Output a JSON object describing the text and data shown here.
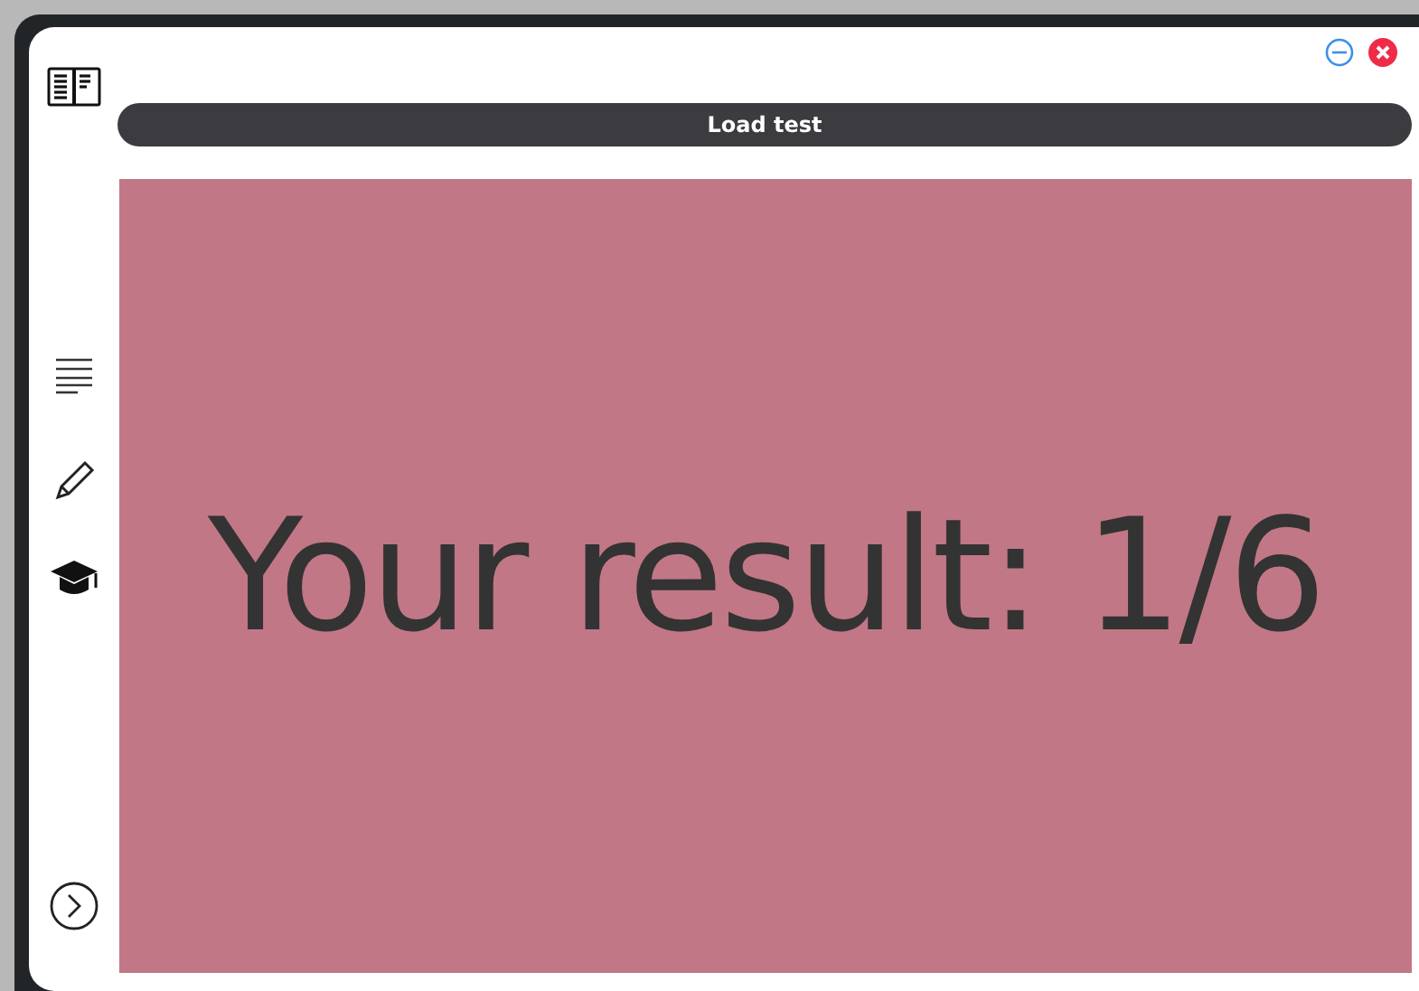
{
  "toolbar": {
    "button": "Load test"
  },
  "result": {
    "text": "Your result: 1/6"
  }
}
